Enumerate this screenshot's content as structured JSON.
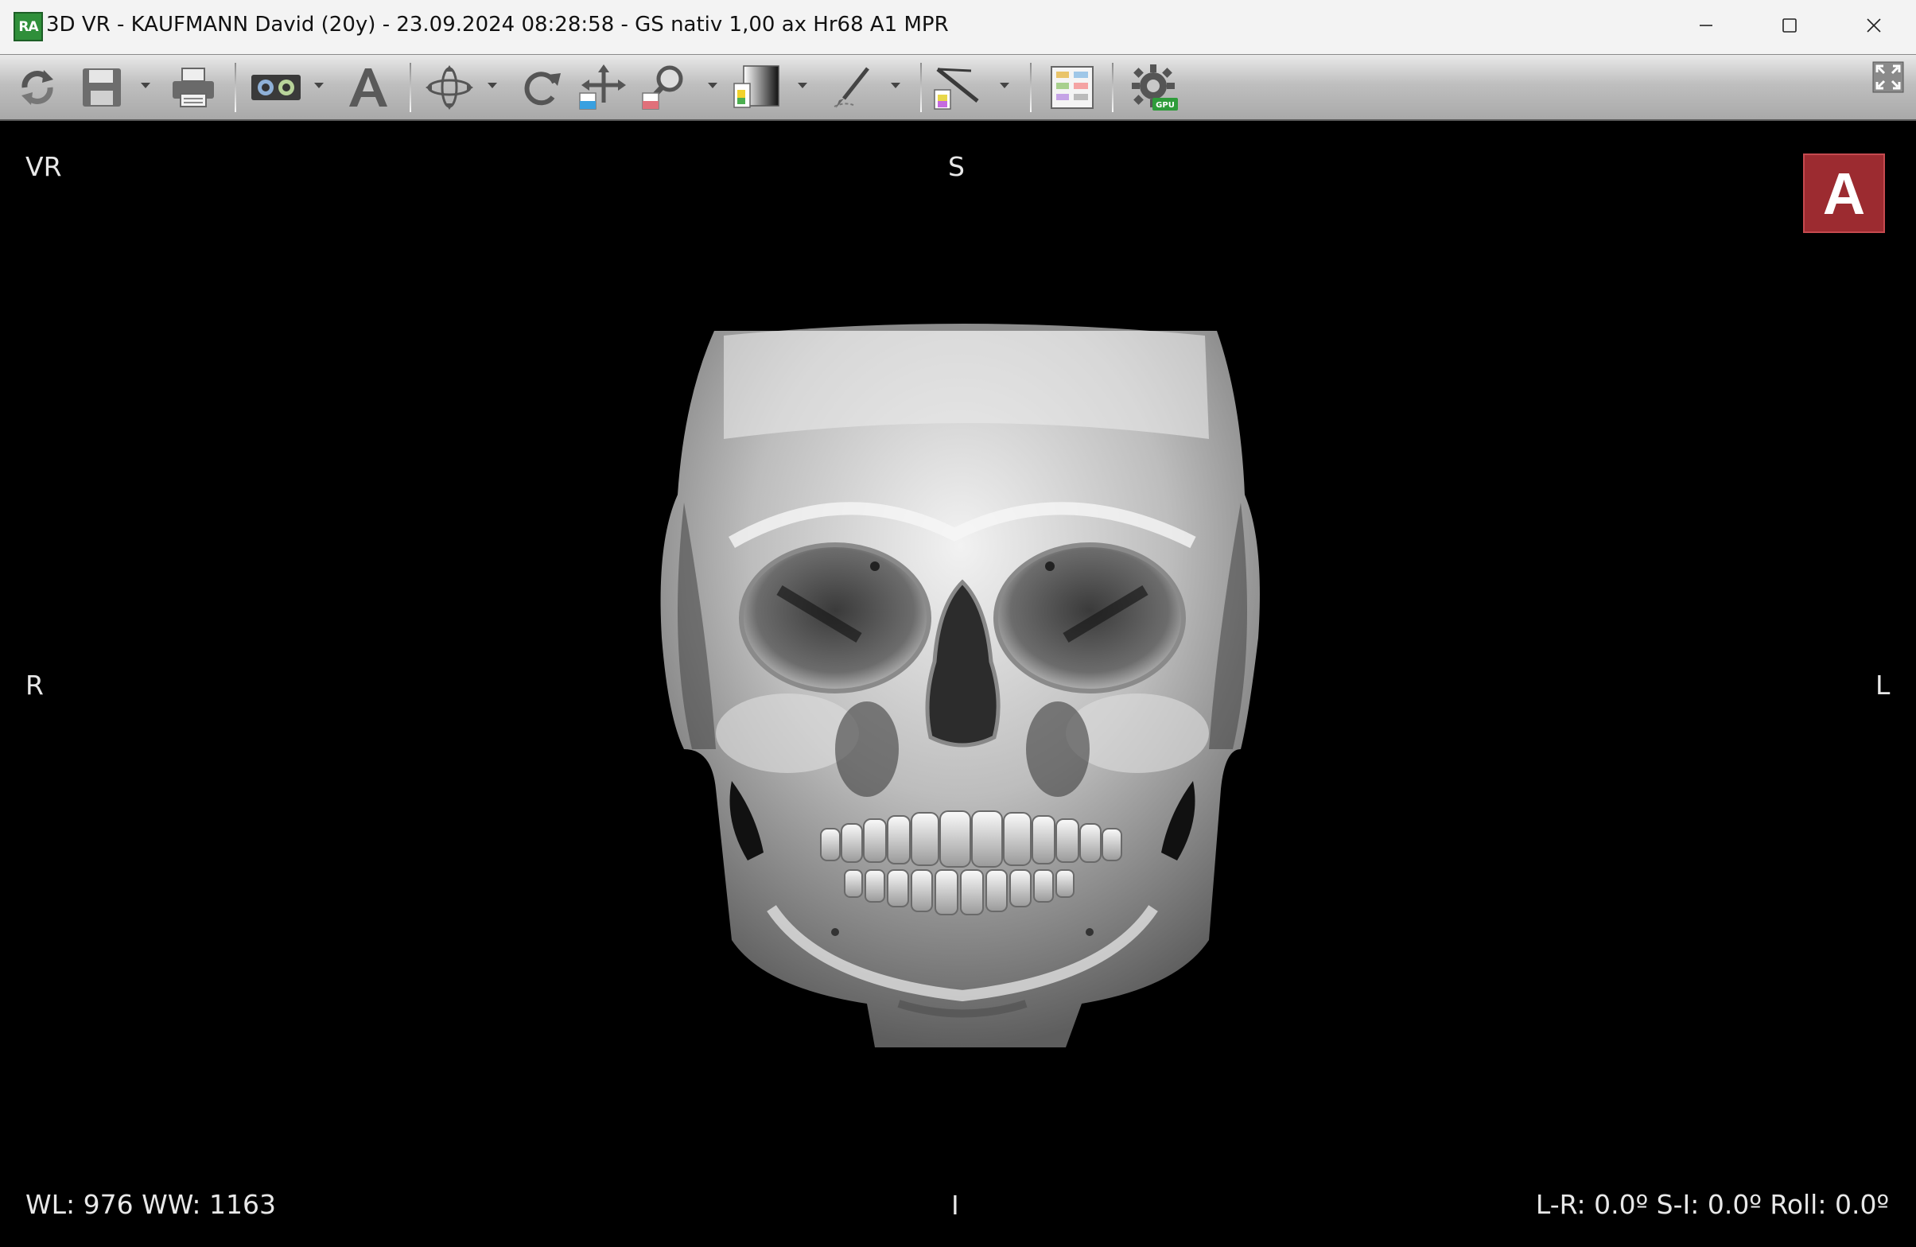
{
  "window": {
    "app_icon_text": "RA",
    "title": "3D VR - KAUFMANN David (20y) - 23.09.2024 08:28:58 - GS nativ 1,00 ax Hr68 A1 MPR",
    "controls": [
      "minimize-icon",
      "maximize-icon",
      "close-icon"
    ]
  },
  "toolbar": {
    "items": [
      {
        "name": "reset-view",
        "icon": "refresh-icon"
      },
      {
        "name": "save",
        "icon": "floppy-icon",
        "has_dropdown": true
      },
      {
        "name": "print",
        "icon": "printer-icon"
      },
      {
        "name": "stereo-view",
        "icon": "3d-glasses-icon",
        "has_dropdown": true
      },
      {
        "name": "annotation",
        "icon": "text-A-icon"
      },
      {
        "name": "rotate-3d",
        "icon": "rotate-3d-icon",
        "has_dropdown": true
      },
      {
        "name": "rotate",
        "icon": "rotate-icon"
      },
      {
        "name": "pan",
        "icon": "pan-icon"
      },
      {
        "name": "zoom",
        "icon": "magnifier-icon",
        "has_dropdown": true
      },
      {
        "name": "window-level",
        "icon": "window-level-icon",
        "has_dropdown": true
      },
      {
        "name": "scalpel",
        "icon": "scalpel-icon",
        "has_dropdown": true
      },
      {
        "name": "measure",
        "icon": "angle-measure-icon",
        "has_dropdown": true
      },
      {
        "name": "layout",
        "icon": "layout-grid-icon"
      },
      {
        "name": "gpu-settings",
        "icon": "gear-gpu-icon",
        "badge": "GPU"
      },
      {
        "name": "fullscreen",
        "icon": "fullscreen-icon"
      }
    ]
  },
  "viewport": {
    "mode_label": "VR",
    "orientation": {
      "top": "S",
      "bottom": "I",
      "left": "R",
      "right": "L"
    },
    "view_badge": "A",
    "window_level_text": "WL: 976 WW: 1163",
    "angles_text": "L-R: 0.0º S-I: 0.0º Roll: 0.0º"
  },
  "colors": {
    "titlebar_bg": "#f3f3f3",
    "toolbar_bg": "#b5b5b5",
    "viewport_bg": "#000000",
    "badge_bg": "#9c2b30",
    "overlay_text": "#e8e8e8"
  }
}
